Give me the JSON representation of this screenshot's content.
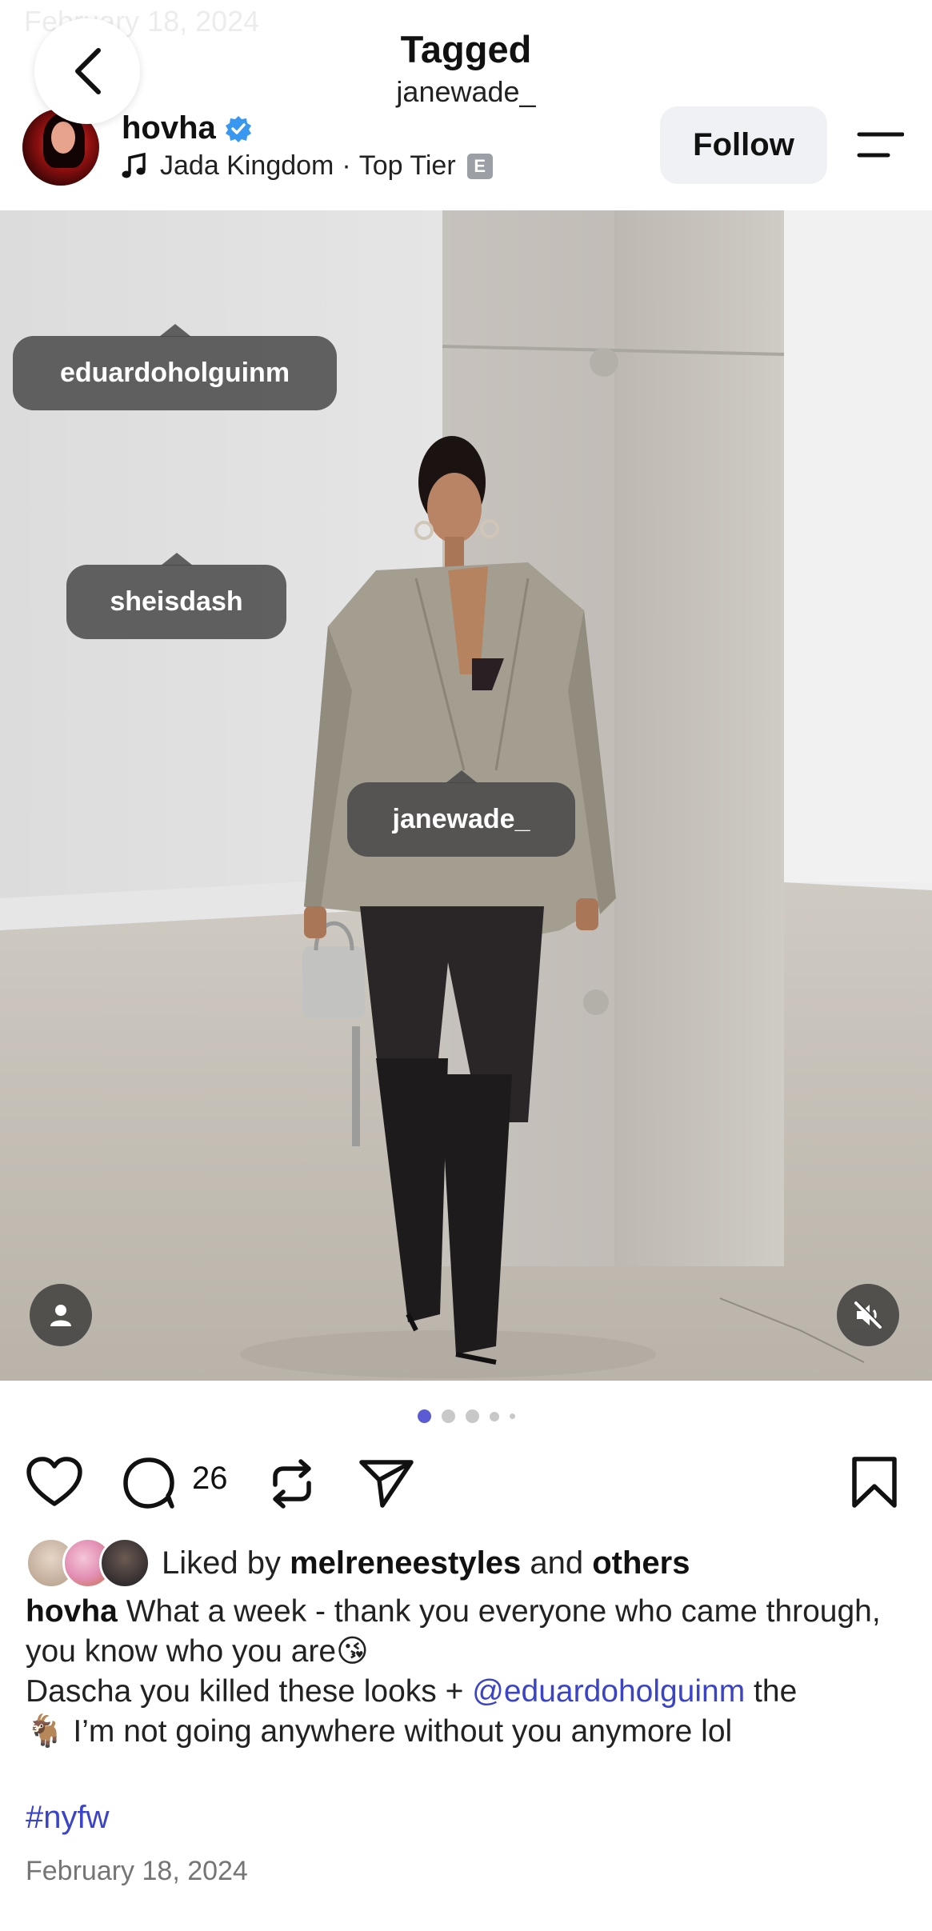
{
  "ghost_date": "February 18, 2024",
  "header": {
    "title": "Tagged",
    "subtitle": "janewade_"
  },
  "post": {
    "username": "hovha",
    "verified": true,
    "audio": {
      "artist": "Jada Kingdom",
      "separator": "·",
      "track": "Top Tier",
      "explicit_badge": "E"
    },
    "follow_label": "Follow",
    "tags": [
      "eduardoholguinm",
      "sheisdash",
      "janewade_"
    ],
    "carousel": {
      "total": 5,
      "active": 1
    },
    "comment_count": "26",
    "liked_by": {
      "prefix": "Liked by",
      "user": "melreneestyles",
      "middle": "and",
      "others": "others"
    },
    "caption": {
      "username": "hovha",
      "line1": "What a week - thank you everyone who came through, you know who you are😘",
      "line2_before": "Dascha you killed these looks + ",
      "mention": "@eduardoholguinm",
      "line2_after": " the",
      "line3": "🐐 I’m not going anywhere without you anymore lol"
    },
    "hashtag": "#nyfw",
    "date": "February 18, 2024"
  },
  "colors": {
    "accent_link": "#3b44c9",
    "verified": "#3897f0",
    "active_dot": "#5b5bd6",
    "follow_bg": "#eff1f5"
  },
  "icons": {
    "back": "chevron-left-icon",
    "verified": "verified-badge-icon",
    "music": "music-note-icon",
    "menu": "menu-icon",
    "like": "heart-icon",
    "comment": "comment-icon",
    "repost": "repost-icon",
    "share": "send-icon",
    "save": "bookmark-icon",
    "tagged_users": "person-icon",
    "mute": "speaker-muted-icon"
  }
}
